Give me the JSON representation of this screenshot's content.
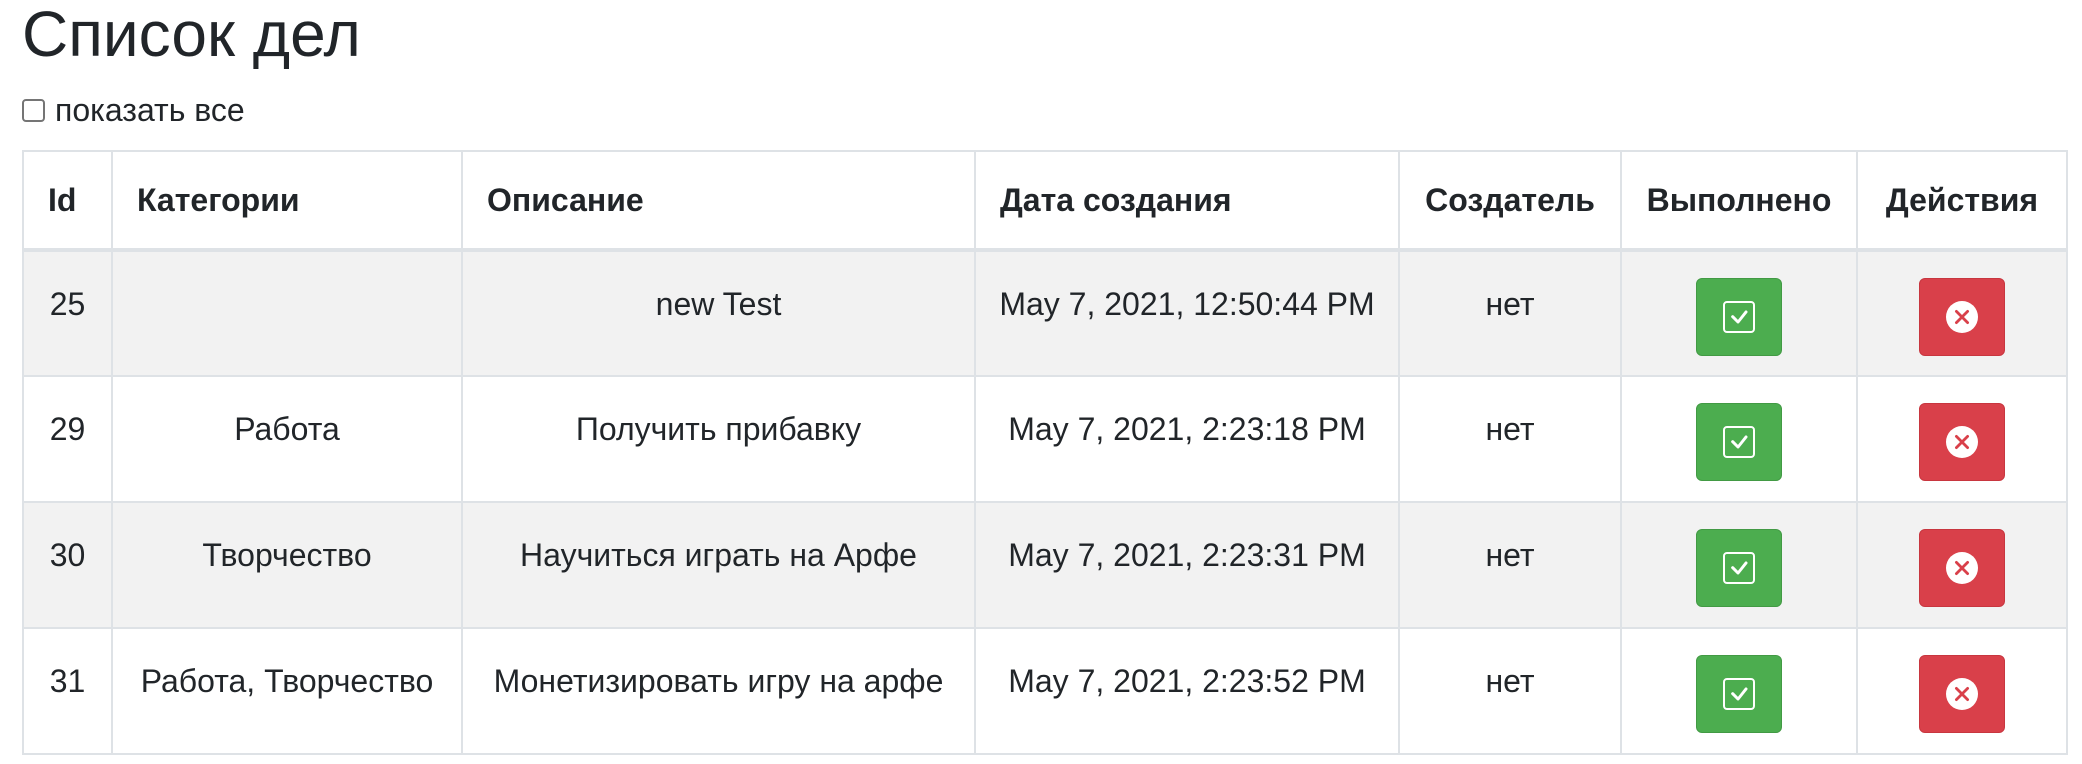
{
  "page": {
    "title": "Список дел",
    "show_all_label": "показать все",
    "show_all_checked": false
  },
  "table": {
    "headers": [
      "Id",
      "Категории",
      "Описание",
      "Дата создания",
      "Создатель",
      "Выполнено",
      "Действия"
    ],
    "rows": [
      {
        "id": "25",
        "categories": "",
        "description": "new Test",
        "created": "May 7, 2021, 12:50:44 PM",
        "creator": "нет"
      },
      {
        "id": "29",
        "categories": "Работа",
        "description": "Получить прибавку",
        "created": "May 7, 2021, 2:23:18 PM",
        "creator": "нет"
      },
      {
        "id": "30",
        "categories": "Творчество",
        "description": "Научиться играть на Арфе",
        "created": "May 7, 2021, 2:23:31 PM",
        "creator": "нет"
      },
      {
        "id": "31",
        "categories": "Работа, Творчество",
        "description": "Монетизировать игру на арфе",
        "created": "May 7, 2021, 2:23:52 PM",
        "creator": "нет"
      }
    ]
  },
  "icons": {
    "done": "check-square-icon",
    "delete": "x-circle-icon"
  },
  "colors": {
    "done_button": "#4cad4f",
    "delete_button": "#d9404a",
    "stripe": "#f2f2f2",
    "border": "#dee2e6"
  }
}
